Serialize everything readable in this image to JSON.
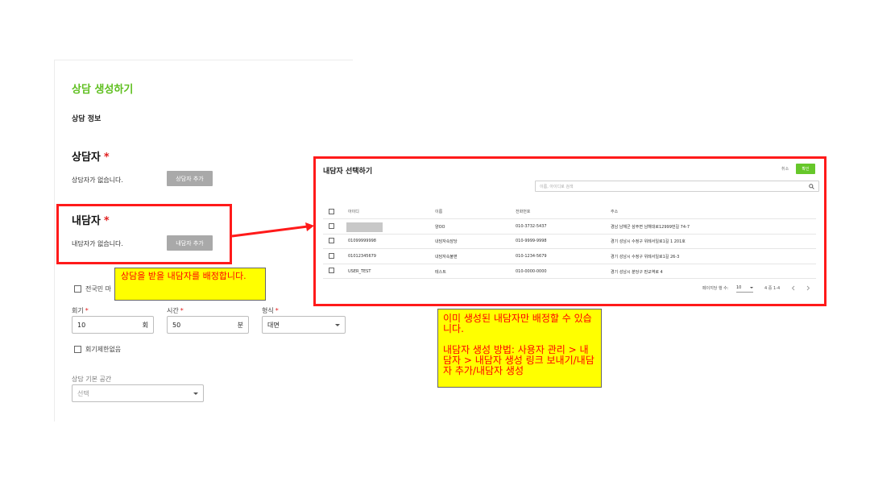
{
  "page": {
    "title": "상담 생성하기",
    "section_title": "상담 정보",
    "counselee": {
      "heading": "상담자",
      "required_mark": "*",
      "empty_text": "상담자가 없습니다.",
      "add_button": "상담자 추가"
    },
    "counselor": {
      "heading": "내담자",
      "required_mark": "*",
      "empty_text": "내담자가 없습니다.",
      "add_button": "내담자 추가"
    },
    "nationwide_checkbox_label": "전국민 마",
    "session_count": {
      "label": "회기",
      "required_mark": "*",
      "value": "10",
      "unit": "회"
    },
    "duration": {
      "label": "시간",
      "required_mark": "*",
      "value": "50",
      "unit": "분"
    },
    "format": {
      "label": "형식",
      "required_mark": "*",
      "value": "대면"
    },
    "no_limit_checkbox_label": "회기제한없음",
    "base_space": {
      "label": "상담 기본 공간",
      "placeholder": "선택"
    }
  },
  "notes": {
    "assign_note": "상담을 받을 내담자를 배정합니다.",
    "modal_note_line1": "이미 생성된 내담자만 배정할 수 있습니다.",
    "modal_note_line2": "내담자 생성 방법: 사용자 관리 > 내담자 > 내담자 생성 링크 보내기/내담자 추가/내담자 생성"
  },
  "modal": {
    "title": "내담자 선택하기",
    "cancel_label": "취소",
    "confirm_label": "확인",
    "search_placeholder": "이름, 아이디로 검색",
    "columns": [
      "아이디",
      "이름",
      "전화번호",
      "주소"
    ],
    "rows": [
      {
        "id": "",
        "name": "양OO",
        "phone": "010-3732-5437",
        "address": "경남 남해군 삼주면 남해대로12999번길 74-7"
      },
      {
        "id": "01099999998",
        "name": "내담자속담당",
        "phone": "010-9999-9998",
        "address": "경기 성남시 수정구 위례서일로1길 1 201호"
      },
      {
        "id": "01012345679",
        "name": "내담자속불편",
        "phone": "010-1234-5679",
        "address": "경기 성남시 수정구 위례서일로1길 26-3"
      },
      {
        "id": "USER_TEST",
        "name": "테스트",
        "phone": "010-0000-0000",
        "address": "경기 성남시 분당구 판교역로 4"
      }
    ],
    "pagination": {
      "rows_per_page_label": "페이지당 행 수:",
      "rows_per_page": "10",
      "range": "4 중 1-4"
    }
  },
  "colors": {
    "accent_green": "#5fbf1f",
    "confirm_green": "#66c72a",
    "highlight_red": "#ff1a1a",
    "note_yellow": "#ffff00",
    "masked_gray": "#c8c8c8"
  },
  "icons": {
    "search": "search-icon",
    "dropdown": "chevron-down-icon",
    "prev": "chevron-left-icon",
    "next": "chevron-right-icon"
  }
}
